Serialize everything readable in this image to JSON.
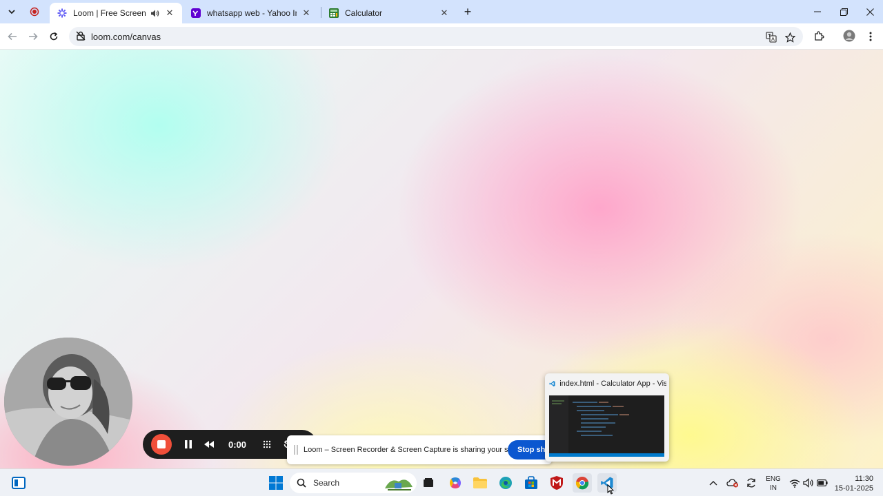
{
  "browser": {
    "tabs": [
      {
        "title": "Loom | Free Screen & Video Recording",
        "active": true
      },
      {
        "title": "whatsapp web - Yahoo India Search Results",
        "active": false
      },
      {
        "title": "Calculator",
        "active": false
      }
    ],
    "address": "loom.com/canvas"
  },
  "recorder": {
    "timer": "0:00"
  },
  "share_notice": {
    "message": "Loom – Screen Recorder & Screen Capture is sharing your screen.",
    "stop_label": "Stop sharing"
  },
  "taskbar_preview": {
    "title": "index.html - Calculator App - Visual Studio Code"
  },
  "taskbar": {
    "search_label": "Search",
    "language_top": "ENG",
    "language_bottom": "IN",
    "time": "11:30",
    "date": "15-01-2025"
  },
  "colors": {
    "tabstrip": "#d3e3fd",
    "record_red": "#f04f3a",
    "share_blue": "#0b57d0"
  }
}
